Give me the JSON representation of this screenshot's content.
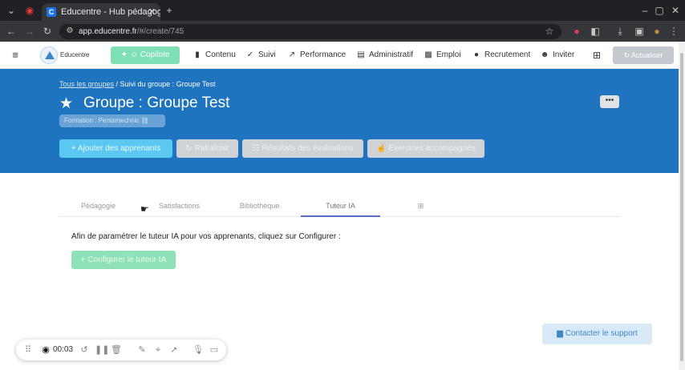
{
  "browser": {
    "tab_title": "Educentre - Hub pédagog",
    "url_host": "app.educentre.fr",
    "url_path": "/#/create/745",
    "new_tab_icon": "plus-icon",
    "close_icon": "close-icon"
  },
  "header": {
    "logo_text": "Educentre",
    "copilote_label": "Copilote",
    "nav": [
      {
        "label": "Contenu",
        "icon": "bookmark-icon"
      },
      {
        "label": "Suivi",
        "icon": "check-circle-icon"
      },
      {
        "label": "Performance",
        "icon": "chart-icon"
      },
      {
        "label": "Administratif",
        "icon": "file-icon"
      },
      {
        "label": "Emploi",
        "icon": "briefcase-icon"
      },
      {
        "label": "Recrutement",
        "icon": "user-icon"
      },
      {
        "label": "Inviter",
        "icon": "add-user-icon"
      }
    ],
    "actualiser_label": "Actualiser"
  },
  "banner": {
    "breadcrumb_link": "Tous les groupes",
    "breadcrumb_current": " / Suivi du groupe : Groupe Test",
    "title": "Groupe : Groupe Test",
    "tag": "Formation : Pentamechnic",
    "more_label": "•••",
    "buttons": {
      "add_learners": "Ajouter des apprenants",
      "refresh": "Rafraîchir",
      "eval_results": "Résultats des évaluations",
      "accompanied_exercises": "Exercices accompagnés"
    }
  },
  "tabs": [
    {
      "label": "Pédagogie"
    },
    {
      "label": "Satisfactions"
    },
    {
      "label": "Bibliothèque"
    },
    {
      "label": "Tuteur IA"
    }
  ],
  "content": {
    "instruction": "Afin de paramétrer le tuteur IA pour vos apprenants, cliquez sur Configurer :",
    "configure_label": "Configurer le tuteur IA"
  },
  "support": {
    "label": "Contacter le support"
  },
  "recorder": {
    "time": "00:03"
  }
}
